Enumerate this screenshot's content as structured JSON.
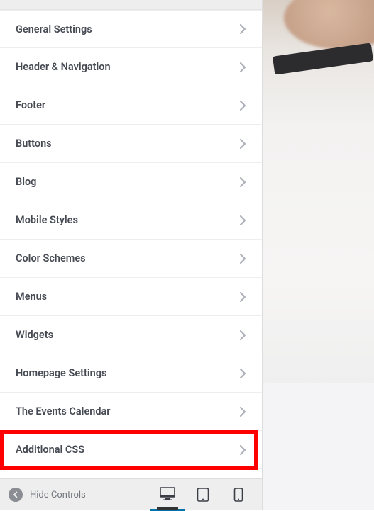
{
  "sidebar": {
    "items": [
      {
        "label": "General Settings"
      },
      {
        "label": "Header & Navigation"
      },
      {
        "label": "Footer"
      },
      {
        "label": "Buttons"
      },
      {
        "label": "Blog"
      },
      {
        "label": "Mobile Styles"
      },
      {
        "label": "Color Schemes"
      },
      {
        "label": "Menus"
      },
      {
        "label": "Widgets"
      },
      {
        "label": "Homepage Settings"
      },
      {
        "label": "The Events Calendar"
      },
      {
        "label": "Additional CSS"
      }
    ]
  },
  "footer": {
    "collapse_label": "Hide Controls",
    "devices": {
      "desktop": "desktop",
      "tablet": "tablet",
      "mobile": "mobile",
      "active": "desktop"
    }
  },
  "highlight": {
    "target_index": 11,
    "color": "#ff0000"
  }
}
